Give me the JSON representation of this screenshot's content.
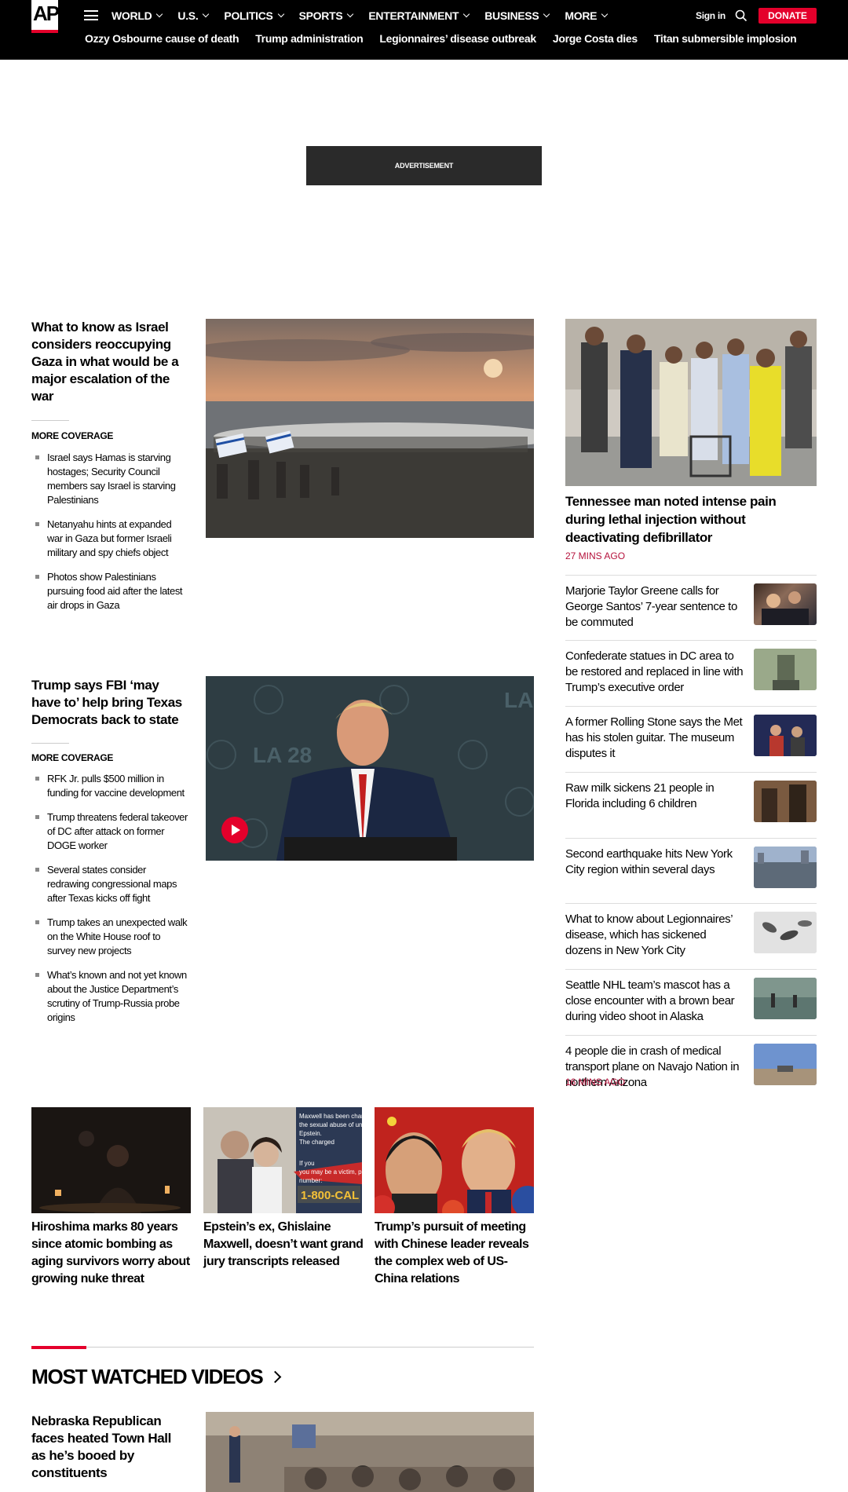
{
  "header": {
    "logo": "AP",
    "nav": [
      "WORLD",
      "U.S.",
      "POLITICS",
      "SPORTS",
      "ENTERTAINMENT",
      "BUSINESS",
      "MORE"
    ],
    "signin": "Sign in",
    "donate": "DONATE",
    "trending": [
      "Ozzy Osbourne cause of death",
      "Trump administration",
      "Legionnaires’ disease outbreak",
      "Jorge Costa dies",
      "Titan submersible implosion"
    ]
  },
  "ad": {
    "label": "ADVERTISEMENT"
  },
  "lead1": {
    "headline": "What to know as Israel considers reoccupying Gaza in what would be a major escalation of the war",
    "more_label": "MORE COVERAGE",
    "more": [
      "Israel says Hamas is starving hostages; Security Council members say Israel is starving Palestinians",
      "Netanyahu hints at expanded war in Gaza but former Israeli military and spy chiefs object",
      "Photos show Palestinians pursuing food aid after the latest air drops in Gaza"
    ]
  },
  "lead2": {
    "headline": "Trump says FBI ‘may have to’ help bring Texas Democrats back to state",
    "more_label": "MORE COVERAGE",
    "more": [
      "RFK Jr. pulls $500 million in funding for vaccine development",
      "Trump threatens federal takeover of DC after attack on former DOGE worker",
      "Several states consider redrawing congressional maps after Texas kicks off fight",
      "Trump takes an unexpected walk on the White House roof to survey new projects",
      "What’s known and not yet known about the Justice Department’s scrutiny of Trump-Russia probe origins"
    ]
  },
  "right": {
    "top_headline": "Tennessee man noted intense pain during lethal injection without deactivating defibrillator",
    "top_time": "27 MINS AGO",
    "items": [
      "Marjorie Taylor Greene calls for George Santos’ 7-year sentence to be commuted",
      "Confederate statues in DC area to be restored and replaced in line with Trump’s executive order",
      "A former Rolling Stone says the Met has his stolen guitar. The museum disputes it",
      "Raw milk sickens 21 people in Florida including 6 children",
      "Second earthquake hits New York City region within several days",
      "What to know about Legionnaires’ disease, which has sickened dozens in New York City",
      "Seattle NHL team’s mascot has a close encounter with a brown bear during video shoot in Alaska",
      "4 people die in crash of medical transport plane on Navajo Nation in northern Arizona"
    ],
    "last_time": "16 MINS AGO"
  },
  "cards": [
    "Hiroshima marks 80 years since atomic bombing as aging survivors worry about growing nuke threat",
    "Epstein’s ex, Ghislaine Maxwell, doesn’t want grand jury transcripts released",
    "Trump’s pursuit of meeting with Chinese leader reveals the complex web of US-China relations"
  ],
  "epstein_sign": {
    "lines": [
      "Maxwell has been charg",
      "the sexual abuse of und",
      "Epstein.",
      "The charged",
      "If you",
      "you may be a victim, p",
      "number:"
    ],
    "phone": "1-800-CAL"
  },
  "video_badge": "LA 28",
  "most_watched": {
    "title": "MOST WATCHED VIDEOS",
    "headline": "Nebraska Republican faces heated Town Hall as he’s booed by constituents"
  },
  "colors": {
    "accent": "#e4002b",
    "time": "#b5123c"
  }
}
